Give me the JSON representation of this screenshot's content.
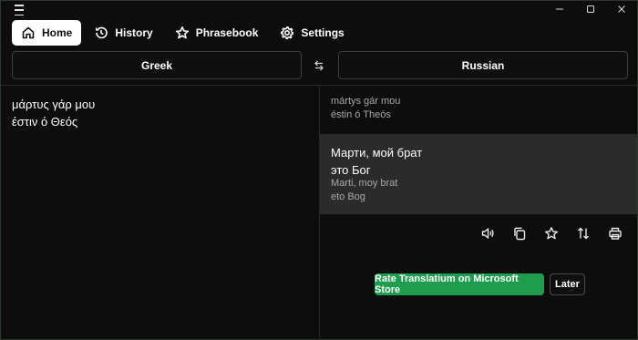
{
  "nav": {
    "items": [
      {
        "label": "Home",
        "icon": "home-icon",
        "active": true
      },
      {
        "label": "History",
        "icon": "history-icon"
      },
      {
        "label": "Phrasebook",
        "icon": "star-icon"
      },
      {
        "label": "Settings",
        "icon": "gear-icon"
      }
    ]
  },
  "languages": {
    "source": "Greek",
    "target": "Russian"
  },
  "source": {
    "text": "μάρτυς γάρ μου\nέστιν ό Θεός",
    "transliteration": "mártys gár mou\néstin ó Theós"
  },
  "result": {
    "text": "Марти, мой брат\nэто Бог",
    "transliteration": "Marti, moy brat\neto Bog"
  },
  "toolbar": {
    "icons": [
      "speaker-icon",
      "copy-icon",
      "star-icon",
      "swap-vertical-icon",
      "print-icon"
    ]
  },
  "prompt": {
    "rate_label": "Rate Translatium on Microsoft Store",
    "later_label": "Later"
  },
  "colors": {
    "background": "#0d0d0d",
    "result_panel": "#2b2b2b",
    "accent_green": "#1f9d4f",
    "active_tab": "#ffffff"
  }
}
